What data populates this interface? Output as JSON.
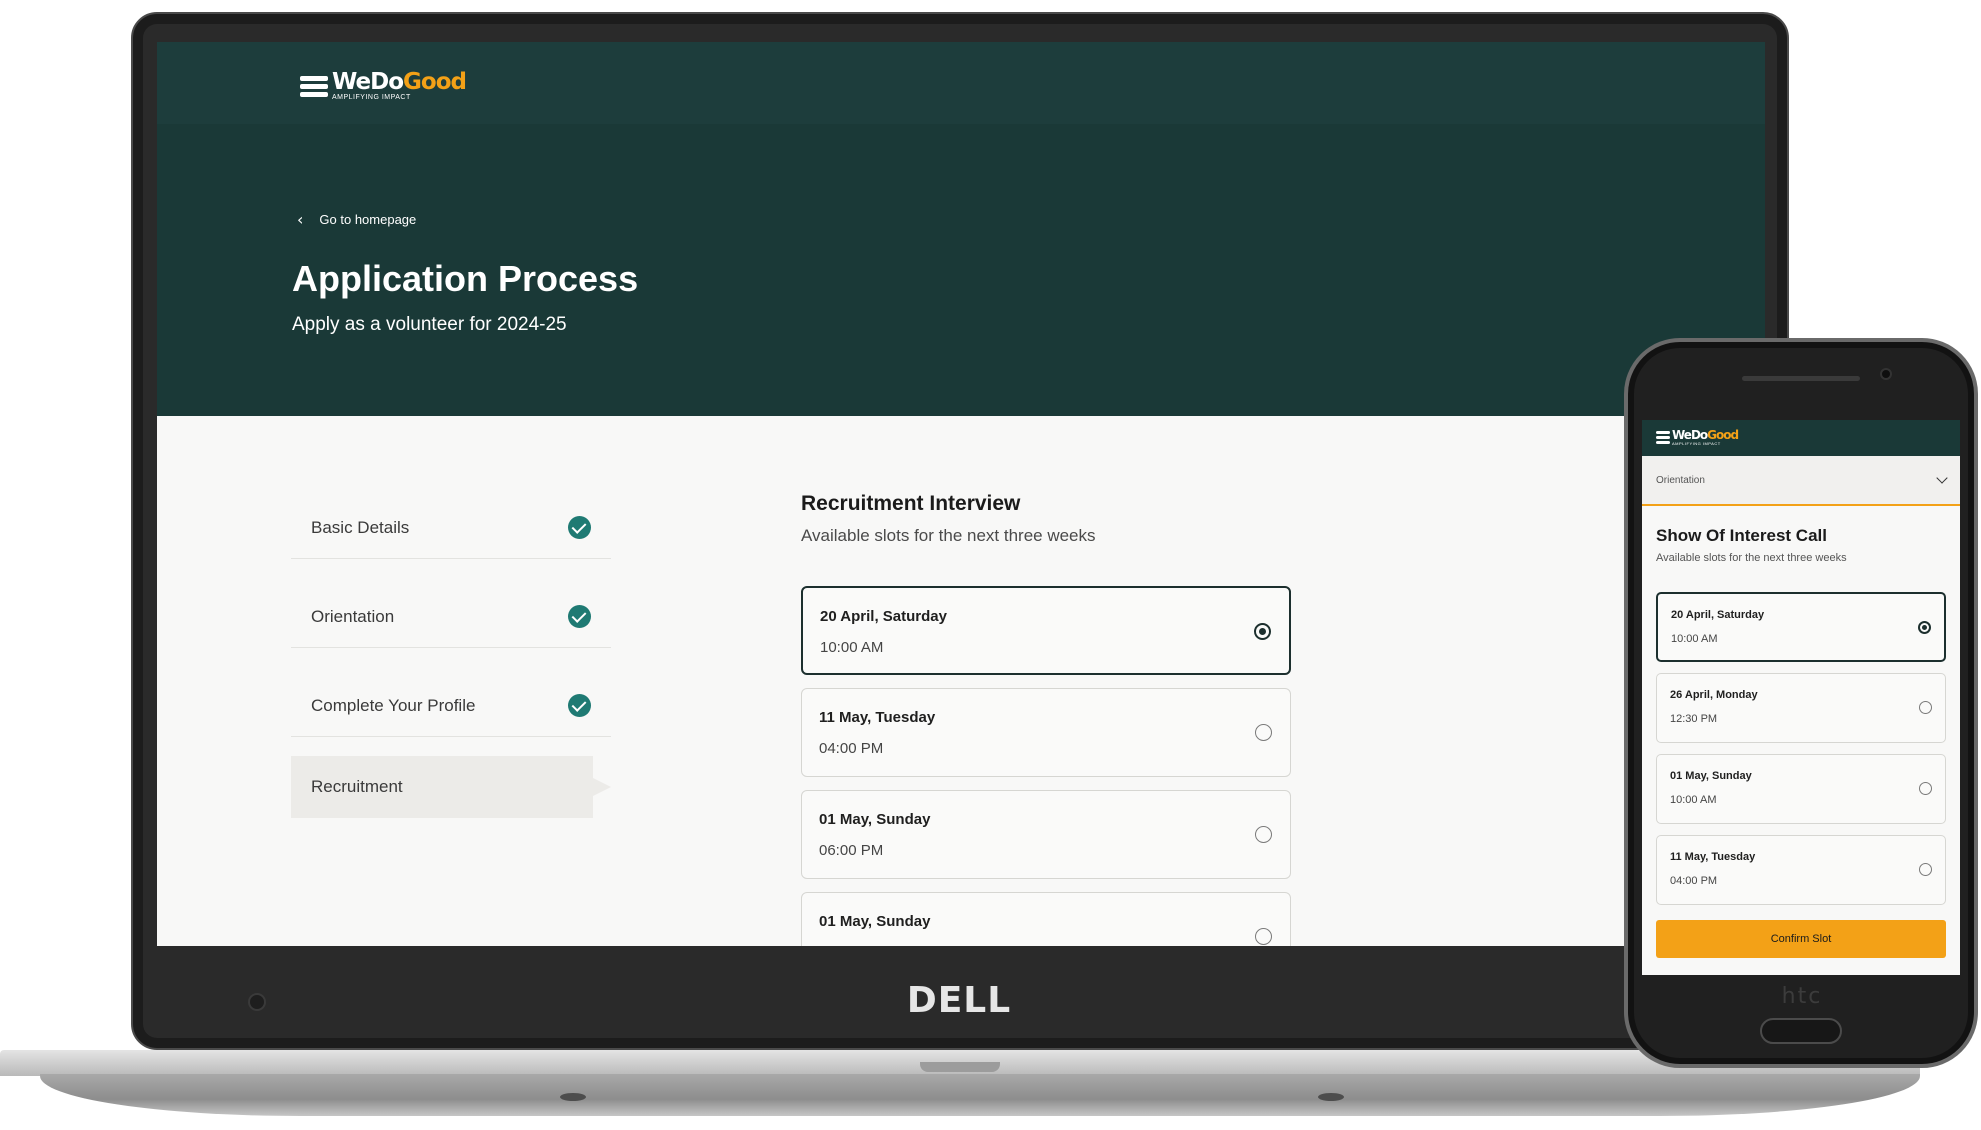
{
  "brand": {
    "name_part1": "WeDo",
    "name_part2": "Good",
    "tagline": "AMPLIFYING IMPACT",
    "accent_color": "#f3a117",
    "primary_color": "#1a3937"
  },
  "laptop": {
    "device_logo": "DELL",
    "back_link": "Go to homepage",
    "title": "Application Process",
    "subtitle": "Apply as a volunteer for 2024-25",
    "steps": [
      {
        "label": "Basic Details",
        "completed": true
      },
      {
        "label": "Orientation",
        "completed": true
      },
      {
        "label": "Complete Your Profile",
        "completed": true
      },
      {
        "label": "Recruitment",
        "completed": false,
        "active": true
      }
    ],
    "section_title": "Recruitment Interview",
    "section_subtitle": "Available slots for the next three weeks",
    "slots": [
      {
        "date": "20 April, Saturday",
        "time": "10:00 AM",
        "selected": true
      },
      {
        "date": "11 May, Tuesday",
        "time": "04:00 PM",
        "selected": false
      },
      {
        "date": "01 May, Sunday",
        "time": "06:00 PM",
        "selected": false
      },
      {
        "date": "01 May, Sunday",
        "time": "",
        "selected": false
      }
    ]
  },
  "phone": {
    "device_logo": "htc",
    "dropdown_value": "Orientation",
    "section_title": "Show Of Interest Call",
    "section_subtitle": "Available slots for the next three weeks",
    "slots": [
      {
        "date": "20 April, Saturday",
        "time": "10:00 AM",
        "selected": true
      },
      {
        "date": "26 April, Monday",
        "time": "12:30 PM",
        "selected": false
      },
      {
        "date": "01 May, Sunday",
        "time": "10:00 AM",
        "selected": false
      },
      {
        "date": "11 May, Tuesday",
        "time": "04:00 PM",
        "selected": false
      }
    ],
    "confirm_label": "Confirm Slot"
  }
}
